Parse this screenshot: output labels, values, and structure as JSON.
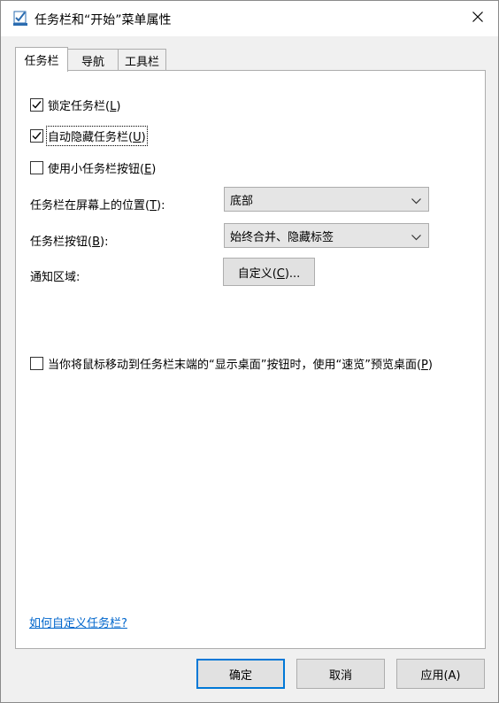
{
  "window": {
    "title": "任务栏和“开始”菜单属性"
  },
  "tabs": [
    {
      "label": "任务栏",
      "active": true
    },
    {
      "label": "导航",
      "active": false
    },
    {
      "label": "工具栏",
      "active": false
    }
  ],
  "options": {
    "lock_taskbar": {
      "label": "锁定任务栏(",
      "key": "L",
      "end": ")",
      "checked": true
    },
    "auto_hide": {
      "label": "自动隐藏任务栏(",
      "key": "U",
      "end": ")",
      "checked": true
    },
    "small_buttons": {
      "label": "使用小任务栏按钮(",
      "key": "E",
      "end": ")",
      "checked": false
    }
  },
  "position": {
    "label": "任务栏在屏幕上的位置(",
    "key": "T",
    "end": "):",
    "value": "底部"
  },
  "buttons_combine": {
    "label": "任务栏按钮(",
    "key": "B",
    "end": "):",
    "value": "始终合并、隐藏标签"
  },
  "notification": {
    "label": "通知区域:",
    "customize_label": "自定义(",
    "customize_key": "C",
    "customize_end": ")..."
  },
  "peek": {
    "label": "当你将鼠标移动到任务栏末端的“显示桌面”按钮时，使用“速览”预览桌面(",
    "key": "P",
    "end": ")",
    "checked": false
  },
  "help_link": "如何自定义任务栏?",
  "footer": {
    "ok": "确定",
    "cancel": "取消",
    "apply": "应用(A)"
  },
  "colors": {
    "accent": "#0078d7",
    "link": "#0066cc",
    "panel": "#ffffff",
    "chrome": "#f0f0f0"
  }
}
